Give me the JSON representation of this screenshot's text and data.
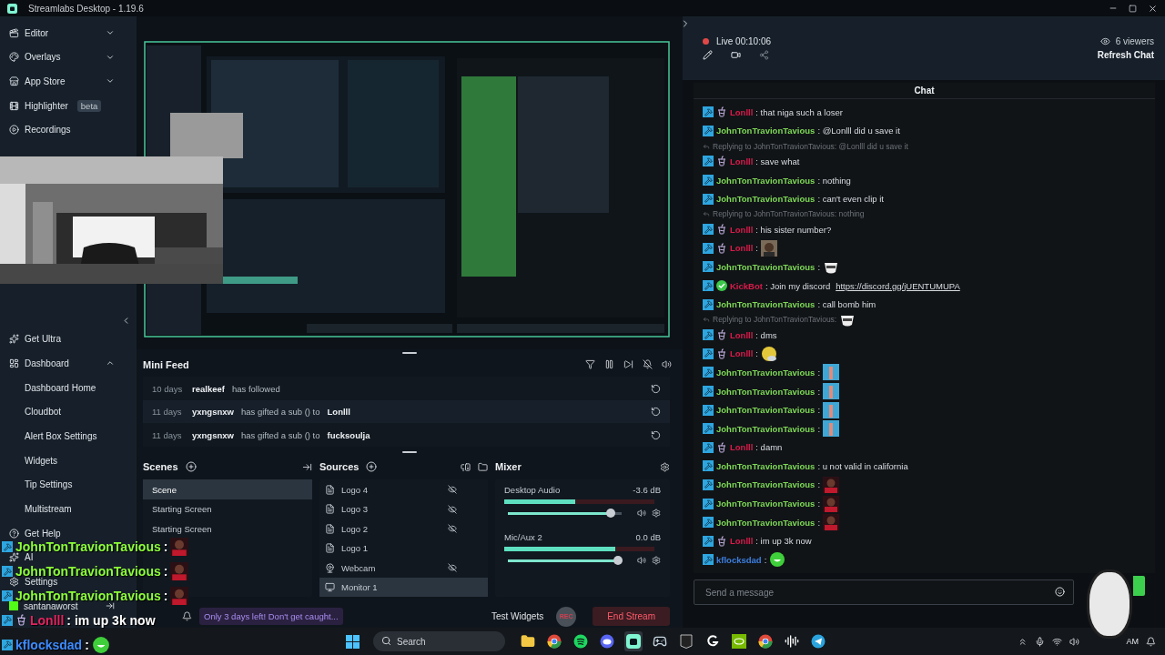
{
  "window": {
    "title": "Streamlabs Desktop - 1.19.6"
  },
  "nav_top": [
    {
      "label": "Editor",
      "expanded": false
    },
    {
      "label": "Overlays",
      "expanded": false
    },
    {
      "label": "App Store",
      "expanded": false
    },
    {
      "label": "Highlighter",
      "badge": "beta"
    },
    {
      "label": "Recordings"
    }
  ],
  "nav_bottom": [
    {
      "label": "Get Ultra"
    },
    {
      "label": "Dashboard",
      "expanded": true,
      "children": [
        {
          "label": "Dashboard Home"
        },
        {
          "label": "Cloudbot"
        },
        {
          "label": "Alert Box Settings"
        },
        {
          "label": "Widgets"
        },
        {
          "label": "Tip Settings"
        },
        {
          "label": "Multistream"
        }
      ]
    },
    {
      "label": "Get Help"
    },
    {
      "label": "AI"
    },
    {
      "label": "Settings"
    }
  ],
  "account": {
    "name": "santanaworst"
  },
  "mini_feed": {
    "title": "Mini Feed",
    "events": [
      {
        "time": "10 days",
        "user": "realkeef",
        "action": "has followed"
      },
      {
        "time": "11 days",
        "user": "yxngsnxw",
        "action": "has gifted a sub () to",
        "target": "Lonlll"
      },
      {
        "time": "11 days",
        "user": "yxngsnxw",
        "action": "has gifted a sub () to",
        "target": "fucksoulja"
      }
    ]
  },
  "scenes": {
    "title": "Scenes",
    "items": [
      {
        "label": "Scene",
        "selected": true
      },
      {
        "label": "Starting Screen",
        "selected": false
      },
      {
        "label": "Starting Screen",
        "selected": false
      }
    ]
  },
  "sources": {
    "title": "Sources",
    "items": [
      {
        "kind": "file",
        "label": "Logo 4",
        "hidden": true,
        "selected": false
      },
      {
        "kind": "file",
        "label": "Logo 3",
        "hidden": true,
        "selected": false
      },
      {
        "kind": "file",
        "label": "Logo 2",
        "hidden": true,
        "selected": false
      },
      {
        "kind": "file",
        "label": "Logo 1",
        "hidden": false,
        "selected": false
      },
      {
        "kind": "webcam",
        "label": "Webcam",
        "hidden": true,
        "selected": false
      },
      {
        "kind": "monitor",
        "label": "Monitor 1",
        "hidden": false,
        "selected": true
      }
    ]
  },
  "mixer": {
    "title": "Mixer",
    "channels": [
      {
        "name": "Desktop Audio",
        "reading": "-3.6 dB",
        "meter": {
          "level": 0.47
        },
        "volume": {
          "level": 0.9
        }
      },
      {
        "name": "Mic/Aux 2",
        "reading": "0.0 dB",
        "meter": {
          "level": 0.74
        },
        "volume": {
          "level": 0.97
        }
      }
    ]
  },
  "footer": {
    "notice": "Only 3 days left! Don't get caught...",
    "test_widgets": "Test Widgets",
    "rec": "REC",
    "end_stream": "End Stream"
  },
  "chat": {
    "live": "Live 00:10:06",
    "viewers": "6 viewers",
    "refresh": "Refresh Chat",
    "title": "Chat",
    "placeholder": "Send a message",
    "messages": [
      {
        "kind": "message",
        "cup": true,
        "verified": false,
        "user": "Lonlll",
        "color": "#d81b4a",
        "text": ": that niga such a loser"
      },
      {
        "kind": "message",
        "cup": false,
        "verified": false,
        "user": "JohnTonTravionTavious",
        "color": "#7ed957",
        "text": ": @Lonlll did u save it"
      },
      {
        "kind": "reply",
        "text": "Replying to JohnTonTravionTavious: @Lonlll did u save it"
      },
      {
        "kind": "message",
        "cup": true,
        "verified": false,
        "user": "Lonlll",
        "color": "#d81b4a",
        "text": ": save what"
      },
      {
        "kind": "message",
        "cup": false,
        "verified": false,
        "user": "JohnTonTravionTavious",
        "color": "#7ed957",
        "text": ": nothing"
      },
      {
        "kind": "message",
        "cup": false,
        "verified": false,
        "user": "JohnTonTravionTavious",
        "color": "#7ed957",
        "text": ": can't even clip it"
      },
      {
        "kind": "reply",
        "text": "Replying to JohnTonTravionTavious: nothing"
      },
      {
        "kind": "message",
        "cup": true,
        "verified": false,
        "user": "Lonlll",
        "color": "#d81b4a",
        "text": ": his sister number?"
      },
      {
        "kind": "message",
        "cup": true,
        "verified": false,
        "user": "Lonlll",
        "color": "#d81b4a",
        "text": ":"
      },
      {
        "kind": "message",
        "cup": false,
        "verified": false,
        "user": "JohnTonTravionTavious",
        "color": "#7ed957",
        "text": ":",
        "emote": {
          "kind": "bear"
        }
      },
      {
        "kind": "message",
        "cup": false,
        "verified": true,
        "user": "KickBot",
        "color": "#d81b4a",
        "text": ": Join my discord",
        "link": "https://discord.gg/jUENTUMUPA"
      },
      {
        "kind": "message",
        "cup": false,
        "verified": false,
        "user": "JohnTonTravionTavious",
        "color": "#7ed957",
        "text": ": call bomb him"
      },
      {
        "kind": "reply",
        "text": "Replying to JohnTonTravionTavious:",
        "emote": {
          "kind": "bear"
        }
      },
      {
        "kind": "message",
        "cup": true,
        "verified": false,
        "user": "Lonlll",
        "color": "#d81b4a",
        "text": ": dms"
      },
      {
        "kind": "message",
        "cup": true,
        "verified": false,
        "user": "Lonlll",
        "color": "#d81b4a",
        "text": ":",
        "emote": {
          "kind": "round"
        }
      },
      {
        "kind": "message",
        "cup": false,
        "verified": false,
        "user": "JohnTonTravionTavious",
        "color": "#7ed957",
        "text": ":",
        "emote": {
          "kind": "tile"
        }
      },
      {
        "kind": "message",
        "cup": false,
        "verified": false,
        "user": "JohnTonTravionTavious",
        "color": "#7ed957",
        "text": ":",
        "emote": {
          "kind": "tile"
        }
      },
      {
        "kind": "message",
        "cup": false,
        "verified": false,
        "user": "JohnTonTravionTavious",
        "color": "#7ed957",
        "text": ":",
        "emote": {
          "kind": "tile"
        }
      },
      {
        "kind": "message",
        "cup": false,
        "verified": false,
        "user": "JohnTonTravionTavious",
        "color": "#7ed957",
        "text": ":",
        "emote": {
          "kind": "tile"
        }
      },
      {
        "kind": "message",
        "cup": true,
        "verified": false,
        "user": "Lonlll",
        "color": "#d81b4a",
        "text": ": damn"
      },
      {
        "kind": "message",
        "cup": false,
        "verified": false,
        "user": "JohnTonTravionTavious",
        "color": "#7ed957",
        "text": ": u not valid in california"
      },
      {
        "kind": "message",
        "cup": false,
        "verified": false,
        "user": "JohnTonTravionTavious",
        "color": "#7ed957",
        "text": ":",
        "emote": {
          "kind": "red"
        }
      },
      {
        "kind": "message",
        "cup": false,
        "verified": false,
        "user": "JohnTonTravionTavious",
        "color": "#7ed957",
        "text": ":",
        "emote": {
          "kind": "red"
        }
      },
      {
        "kind": "message",
        "cup": false,
        "verified": false,
        "user": "JohnTonTravionTavious",
        "color": "#7ed957",
        "text": ":",
        "emote": {
          "kind": "red"
        }
      },
      {
        "kind": "message",
        "cup": true,
        "verified": false,
        "user": "Lonlll",
        "color": "#d81b4a",
        "text": ": im up 3k now"
      },
      {
        "kind": "message",
        "cup": false,
        "verified": false,
        "user": "kflocksdad",
        "color": "#3d7fe0",
        "text": ":",
        "emote": {
          "kind": "green"
        }
      }
    ]
  },
  "overlay_chat": [
    {
      "user": "JohnTonTravionTavious",
      "color": "#8cff3a",
      "text": ":",
      "cup": false,
      "emote": {
        "kind": "red"
      }
    },
    {
      "user": "JohnTonTravionTavious",
      "color": "#8cff3a",
      "text": ":",
      "cup": false,
      "emote": {
        "kind": "red"
      }
    },
    {
      "user": "JohnTonTravionTavious",
      "color": "#8cff3a",
      "text": ":",
      "cup": false,
      "emote": {
        "kind": "red"
      }
    },
    {
      "user": "Lonlll",
      "color": "#e0245e",
      "text": ": im up 3k now",
      "cup": true
    },
    {
      "user": "kflocksdad",
      "color": "#3d8bff",
      "text": ":",
      "cup": false,
      "emote": {
        "kind": "green"
      }
    }
  ],
  "taskbar": {
    "placeholder": "Search",
    "apps": [
      {
        "kind": "folder",
        "selected": false
      },
      {
        "kind": "chrome",
        "selected": false
      },
      {
        "kind": "spotify",
        "selected": false
      },
      {
        "kind": "discord",
        "selected": false
      },
      {
        "kind": "streamlabs",
        "selected": true
      },
      {
        "kind": "steam",
        "selected": false
      },
      {
        "kind": "epic",
        "selected": false
      },
      {
        "kind": "logitech",
        "selected": false
      },
      {
        "kind": "nvidia",
        "selected": false
      },
      {
        "kind": "chrome",
        "selected": false
      },
      {
        "kind": "audio",
        "selected": false
      },
      {
        "kind": "telegram",
        "selected": false
      }
    ],
    "clock": "AM"
  }
}
